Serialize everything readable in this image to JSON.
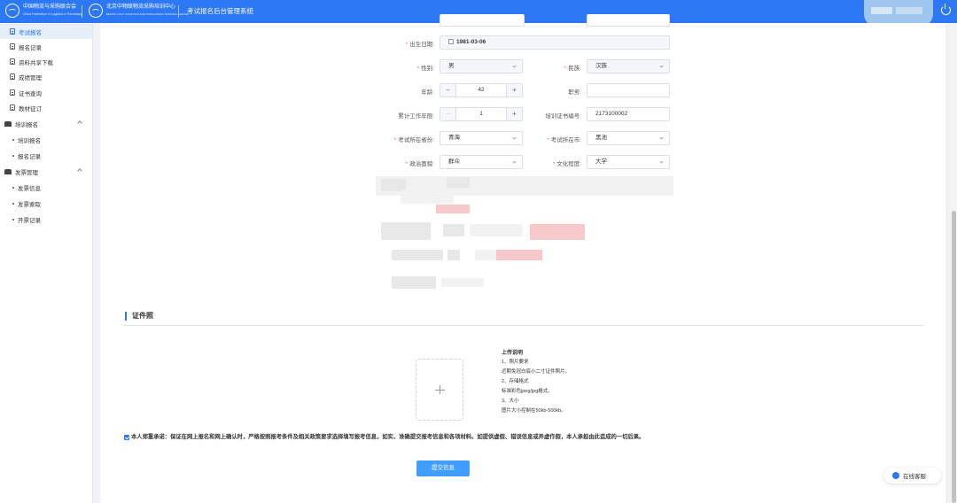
{
  "header": {
    "logo1_cn": "中国物流与采购联合会",
    "logo1_en": "China Federation of Logistics & Purchasing",
    "logo2_cn": "北京中物联物流采购培训中心",
    "logo2_en": "BEIJING CFLP LOGISTICS AND PURCHASING TRAINING CENTER",
    "system_title": "考试报名后台管理系统"
  },
  "sidebar": {
    "items": [
      {
        "label": "考试报名",
        "active": true
      },
      {
        "label": "报名记录"
      },
      {
        "label": "资料共享下载"
      },
      {
        "label": "成绩管理"
      },
      {
        "label": "证书查询"
      },
      {
        "label": "教材征订"
      }
    ],
    "groups": [
      {
        "label": "培训报名",
        "subs": [
          "培训报名",
          "报名记录"
        ]
      },
      {
        "label": "发票管理",
        "subs": [
          "发票信息",
          "发票索取",
          "开票记录"
        ]
      }
    ]
  },
  "form": {
    "birth": {
      "label": "出生日期:",
      "value": "1981-03-06"
    },
    "gender": {
      "label": "性别:",
      "value": "男"
    },
    "ethnicity": {
      "label": "民族:",
      "value": "汉族"
    },
    "age": {
      "label": "年龄:",
      "value": "42"
    },
    "job": {
      "label": "职务:",
      "value": ""
    },
    "work_years": {
      "label": "累计工作年限:",
      "value": "1"
    },
    "cert_no": {
      "label": "培训证书编号:",
      "value": "2173100002"
    },
    "exam_province": {
      "label": "考试所在省份:",
      "value": "青海"
    },
    "exam_city": {
      "label": "考试所在市:",
      "value": "黑池"
    },
    "politics": {
      "label": "政治面貌:",
      "value": "群众"
    },
    "education": {
      "label": "文化程度:",
      "value": "大学"
    }
  },
  "photo_section": {
    "title": "证件照",
    "instructions": [
      "上传说明",
      "1、照片要求",
      "近期免冠白底小二寸证件照片。",
      "2、存储格式",
      "标准彩色jpeg/jpg格式。",
      "3、大小",
      "图片大小控制在50kb-500kb。"
    ]
  },
  "promise": "本人郑重承诺：保证在网上报名和网上确认时，严格按照报考条件及相关政策要求选择填写报考信息，如实、准确提交报考信息和各项材料。如提供虚假、错误信息或弄虚作假，本人承担由此造成的一切后果。",
  "submit_label": "提交信息",
  "service_label": "在线客服",
  "colors": {
    "primary": "#2c77f4",
    "button": "#409eff",
    "required": "#f56c6c"
  }
}
